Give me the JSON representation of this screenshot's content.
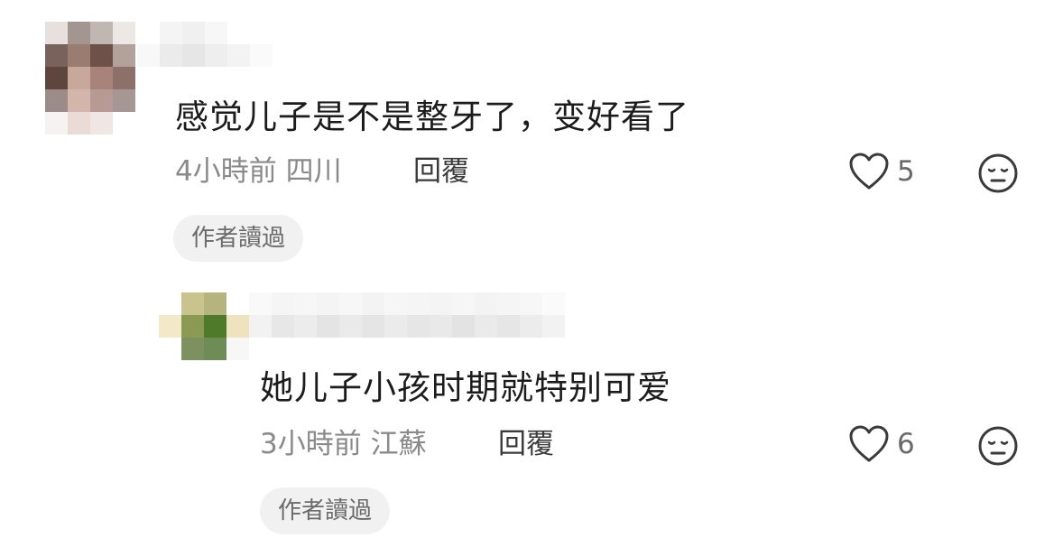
{
  "comments": [
    {
      "text": "感觉儿子是不是整牙了，变好看了",
      "time": "4小時前",
      "location": "四川",
      "reply_label": "回覆",
      "likes": "5",
      "badge": "作者讀過",
      "avatar": "pixelated-avatar",
      "username": "pixelated-username"
    },
    {
      "text": "她儿子小孩时期就特别可爱",
      "time": "3小時前",
      "location": "江蘇",
      "reply_label": "回覆",
      "likes": "6",
      "badge": "作者讀過",
      "avatar": "pixelated-avatar",
      "username": "pixelated-username"
    }
  ],
  "icons": {
    "like": "heart-outline-icon",
    "reaction": "neutral-face-icon"
  },
  "colors": {
    "text_primary": "#1c1c1c",
    "text_secondary": "#8a8a8a",
    "badge_bg": "#f1f1f1"
  }
}
